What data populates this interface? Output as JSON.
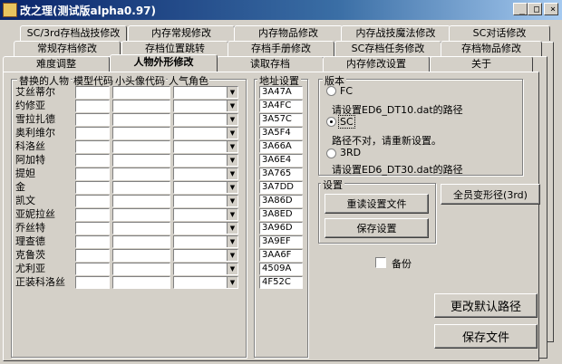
{
  "window": {
    "title": "改之理(测试版alpha0.97)",
    "min": "_",
    "max": "□",
    "close": "×"
  },
  "tabs_row1": [
    "SC/3rd存档战技修改",
    "内存常规修改",
    "内存物品修改",
    "内存战技魔法修改",
    "SC对话修改"
  ],
  "tabs_row2": [
    "常规存档修改",
    "存档位置跳转",
    "存档手册修改",
    "SC存档任务修改",
    "存档物品修改"
  ],
  "tabs_row3": [
    "难度调整",
    "人物外形修改",
    "读取存档",
    "内存修改设置",
    "关于"
  ],
  "replace": {
    "legend": "替换的人物",
    "col_model": "模型代码",
    "col_portrait": "小头像代码",
    "col_popular": "人气角色",
    "characters": [
      "艾丝蒂尔",
      "约修亚",
      "雪拉扎德",
      "奥利维尔",
      "科洛丝",
      "阿加特",
      "提妲",
      "金",
      "凯文",
      "亚妮拉丝",
      "乔丝特",
      "理查德",
      "克鲁茨",
      "尤利亚",
      "正装科洛丝"
    ]
  },
  "address": {
    "legend": "地址设置",
    "values": [
      "3A47A",
      "3A4FC",
      "3A57C",
      "3A5F4",
      "3A66A",
      "3A6E4",
      "3A765",
      "3A7DD",
      "3A86D",
      "3A8ED",
      "3A96D",
      "3A9EF",
      "3AA6F",
      "4509A",
      "4F52C"
    ]
  },
  "version": {
    "legend": "版本",
    "fc": "FC",
    "fc_path": "请设置ED6_DT10.dat的路径",
    "sc": "SC",
    "sc_status": "路径不对，请重新设置。",
    "third": "3RD",
    "third_path": "请设置ED6_DT30.dat的路径",
    "selected": "SC"
  },
  "settings": {
    "legend": "设置",
    "reload": "重读设置文件",
    "save": "保存设置"
  },
  "all_morph": "全员变形径(3rd)",
  "backup": "备份",
  "change_default_path": "更改默认路径",
  "save_file": "保存文件"
}
